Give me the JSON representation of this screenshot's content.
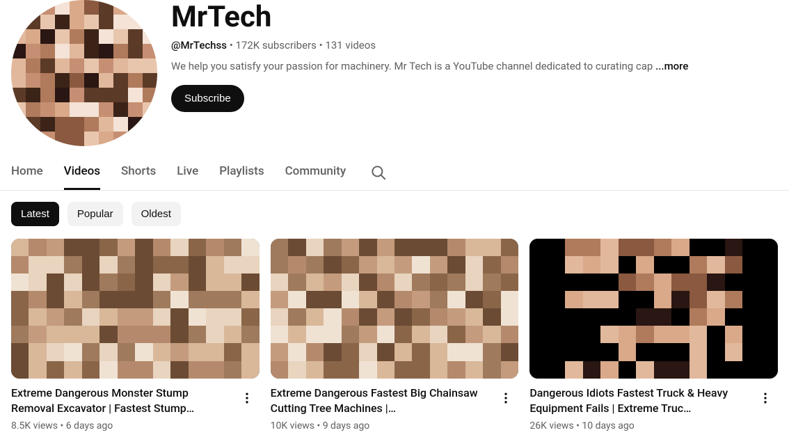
{
  "channel": {
    "name": "MrTech",
    "handle": "@MrTechss",
    "subscribers": "172K subscribers",
    "video_count": "131 videos",
    "description": "We help you satisfy your passion for machinery. Mr Tech is a YouTube channel dedicated to curating cap",
    "more_label": "...more",
    "subscribe_label": "Subscribe"
  },
  "tabs": [
    {
      "label": "Home",
      "active": false
    },
    {
      "label": "Videos",
      "active": true
    },
    {
      "label": "Shorts",
      "active": false
    },
    {
      "label": "Live",
      "active": false
    },
    {
      "label": "Playlists",
      "active": false
    },
    {
      "label": "Community",
      "active": false
    }
  ],
  "filters": [
    {
      "label": "Latest",
      "active": true
    },
    {
      "label": "Popular",
      "active": false
    },
    {
      "label": "Oldest",
      "active": false
    }
  ],
  "videos": [
    {
      "title": "Extreme Dangerous Monster Stump Removal Excavator | Fastest Stump…",
      "views": "8.5K views",
      "age": "6 days ago"
    },
    {
      "title": "Extreme Dangerous Fastest Big Chainsaw Cutting Tree Machines |…",
      "views": "10K views",
      "age": "9 days ago"
    },
    {
      "title": "Dangerous Idiots Fastest Truck & Heavy Equipment Fails | Extreme Truc…",
      "views": "26K views",
      "age": "10 days ago"
    }
  ]
}
